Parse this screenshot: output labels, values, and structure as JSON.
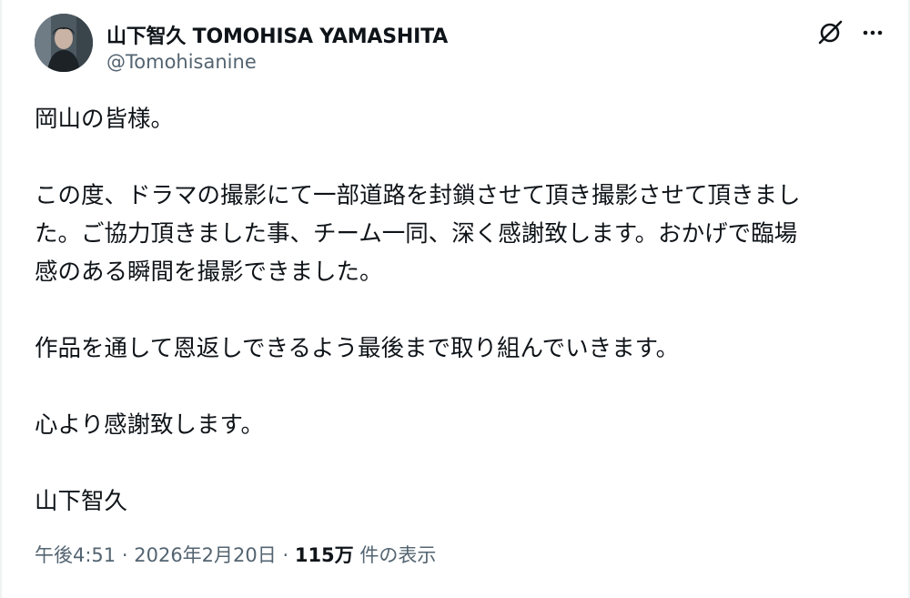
{
  "author": {
    "display_name": "山下智久 TOMOHISA YAMASHITA",
    "handle": "@Tomohisanine"
  },
  "actions": {
    "grok_icon": "grok-icon",
    "more_icon": "more-icon"
  },
  "post": {
    "line1": "岡山の皆様。",
    "line2": "この度、ドラマの撮影にて一部道路を封鎖させて頂き撮影させて頂きまし",
    "line3": "た。ご協力頂きました事、チーム一同、深く感謝致します。おかげで臨場",
    "line4": "感のある瞬間を撮影できました。",
    "line5": "作品を通して恩返しできるよう最後まで取り組んでいきます。",
    "line6": "心より感謝致します。",
    "line7": "山下智久"
  },
  "meta": {
    "time": "午後4:51",
    "date": "2026年2月20日",
    "separator": "·",
    "views_count": "115万",
    "views_label": "件の表示"
  },
  "colors": {
    "text": "#0f1419",
    "secondary": "#536471",
    "border": "#eff3f4"
  }
}
